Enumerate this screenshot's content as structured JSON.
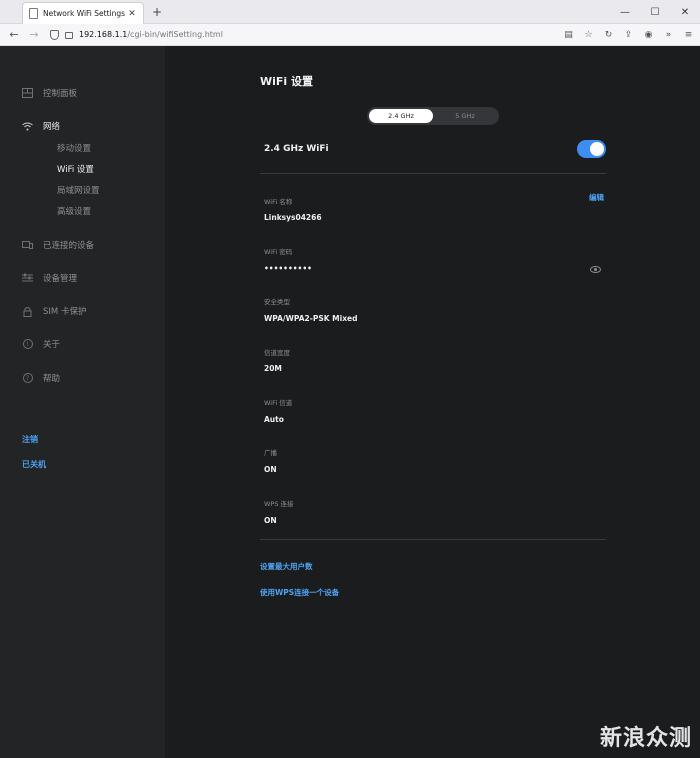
{
  "browser": {
    "tab_title": "Network WiFi Settings",
    "url_host": "192.168.1.1",
    "url_path": "/cgi-bin/wifiSetting.html"
  },
  "sidebar": {
    "items": [
      {
        "label": "控制面板",
        "icon": "dashboard-icon"
      },
      {
        "label": "网络",
        "icon": "wifi-icon"
      },
      {
        "label": "已连接的设备",
        "icon": "devices-icon"
      },
      {
        "label": "设备管理",
        "icon": "sliders-icon"
      },
      {
        "label": "SIM 卡保护",
        "icon": "lock-icon"
      },
      {
        "label": "关于",
        "icon": "info-icon"
      },
      {
        "label": "帮助",
        "icon": "help-icon"
      }
    ],
    "sub_items": [
      "移动设置",
      "WiFi 设置",
      "局域网设置",
      "高级设置"
    ],
    "logout": "注销",
    "shutdown": "已关机"
  },
  "main": {
    "title": "WiFi 设置",
    "bands": [
      "2.4 GHz",
      "5 GHz"
    ],
    "wifi_heading": "2.4 GHz WiFi",
    "wifi_enabled": true,
    "edit": "编辑",
    "fields": [
      {
        "label": "WiFi 名称",
        "value": "Linksys04266"
      },
      {
        "label": "WiFi 密码",
        "value": "••••••••••"
      },
      {
        "label": "安全类型",
        "value": "WPA/WPA2-PSK Mixed"
      },
      {
        "label": "信道宽度",
        "value": "20M"
      },
      {
        "label": "WiFi 信道",
        "value": "Auto"
      },
      {
        "label": "广播",
        "value": "ON"
      },
      {
        "label": "WPS 连接",
        "value": "ON"
      }
    ],
    "links": [
      "设置最大用户数",
      "使用WPS连接一个设备"
    ]
  },
  "watermark": "新浪众测",
  "colors": {
    "accent": "#4da3f5",
    "toggle_on": "#3d8ef0"
  }
}
